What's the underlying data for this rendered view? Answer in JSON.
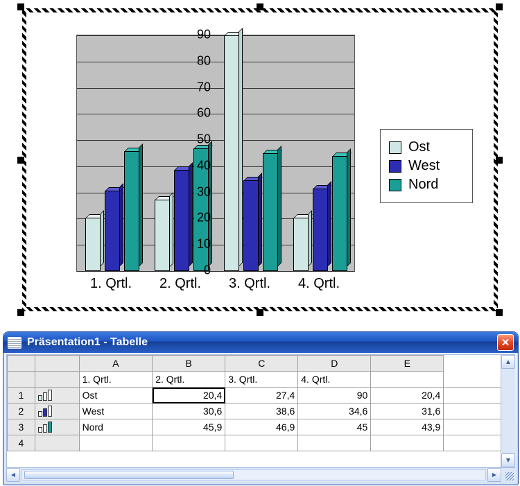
{
  "chart_data": {
    "type": "bar",
    "categories": [
      "1. Qrtl.",
      "2. Qrtl.",
      "3. Qrtl.",
      "4. Qrtl."
    ],
    "series": [
      {
        "name": "Ost",
        "color": "#cfe7e5",
        "values": [
          20.4,
          27.4,
          90,
          20.4
        ]
      },
      {
        "name": "West",
        "color": "#2d2db3",
        "values": [
          30.6,
          38.6,
          34.6,
          31.6
        ]
      },
      {
        "name": "Nord",
        "color": "#1a9e96",
        "values": [
          45.9,
          46.9,
          45,
          43.9
        ]
      }
    ],
    "ylim": [
      0,
      90
    ],
    "y_ticks": [
      0,
      10,
      20,
      30,
      40,
      50,
      60,
      70,
      80,
      90
    ],
    "title": "",
    "xlabel": "",
    "ylabel": ""
  },
  "legend": {
    "items": [
      {
        "key": "ost",
        "label": "Ost"
      },
      {
        "key": "west",
        "label": "West"
      },
      {
        "key": "nord",
        "label": "Nord"
      }
    ]
  },
  "sheet": {
    "window_title": "Präsentation1 - Tabelle",
    "col_headers": [
      "",
      "A",
      "B",
      "C",
      "D",
      "E"
    ],
    "header_row": [
      "",
      "1. Qrtl.",
      "2. Qrtl.",
      "3. Qrtl.",
      "4. Qrtl.",
      ""
    ],
    "rows": [
      {
        "n": "1",
        "label": "Ost",
        "cells": [
          "20,4",
          "27,4",
          "90",
          "20,4",
          ""
        ]
      },
      {
        "n": "2",
        "label": "West",
        "cells": [
          "30,6",
          "38,6",
          "34,6",
          "31,6",
          ""
        ]
      },
      {
        "n": "3",
        "label": "Nord",
        "cells": [
          "45,9",
          "46,9",
          "45",
          "43,9",
          ""
        ]
      },
      {
        "n": "4",
        "label": "",
        "cells": [
          "",
          "",
          "",
          "",
          ""
        ]
      }
    ],
    "selected_cell": "A1"
  }
}
